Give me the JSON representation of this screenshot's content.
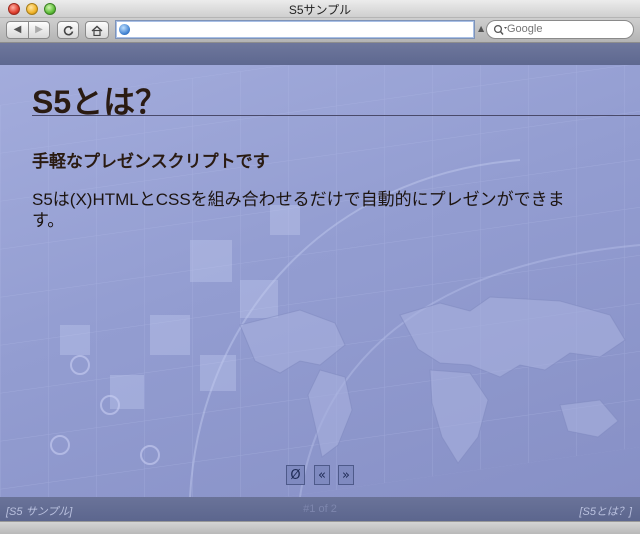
{
  "window": {
    "title": "S5サンプル"
  },
  "toolbar": {
    "back_label": "◀",
    "forward_label": "▶",
    "reload_label": "C",
    "address_value": "",
    "search_placeholder": "Google"
  },
  "slide": {
    "title": "S5とは？",
    "subtitle": "手軽なプレゼンスクリプトです",
    "body": "S5は(X)HTMLとCSSを組み合わせるだけで自動的にプレゼンができます。"
  },
  "controls": {
    "toggle_label": "Ø",
    "prev_label": "«",
    "next_label": "»"
  },
  "footer": {
    "left": "[S5 サンプル]",
    "center": "#1 of 2",
    "right": "[S5とは？]"
  },
  "colors": {
    "slide_bg": "#939dd1",
    "band": "#5e6890",
    "title_text": "#2a1b12"
  }
}
